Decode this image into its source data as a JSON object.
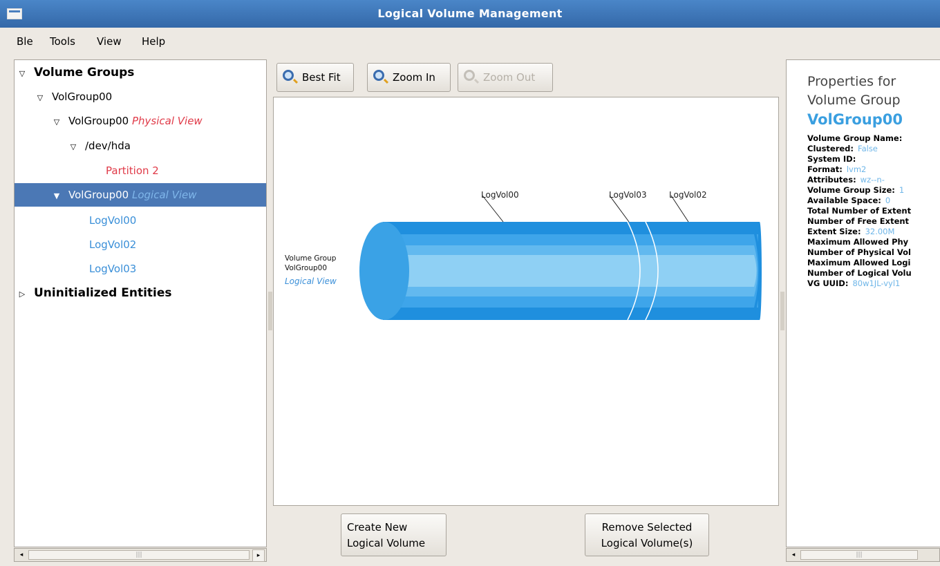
{
  "window": {
    "title": "Logical Volume Management"
  },
  "menu": [
    {
      "label": "File",
      "mnemonic": "F",
      "display": "Ble"
    },
    {
      "label": "Tools",
      "mnemonic": "T",
      "display": "Tools"
    },
    {
      "label": "View",
      "mnemonic": "V",
      "display": "View"
    },
    {
      "label": "Help",
      "mnemonic": "H",
      "display": "Help"
    }
  ],
  "tree": {
    "volume_groups": "Volume Groups",
    "vg": "VolGroup00",
    "vg_physical": "VolGroup00",
    "physical_view": "Physical View",
    "device": "/dev/hda",
    "partition": "Partition 2",
    "vg_logical": "VolGroup00",
    "logical_view": "Logical View",
    "logical_volumes": [
      "LogVol00",
      "LogVol02",
      "LogVol03"
    ],
    "uninitialized": "Uninitialized Entities"
  },
  "toolbar": {
    "best_fit": "Best Fit",
    "zoom_in": "Zoom In",
    "zoom_out": "Zoom Out"
  },
  "diagram": {
    "vg_label_line1": "Volume Group",
    "vg_label_line2": "VolGroup00",
    "vg_label_line3": "Logical View",
    "lv_labels": [
      "LogVol00",
      "LogVol03",
      "LogVol02"
    ],
    "colors": {
      "outer": "#1f8fde",
      "mid": "#57b0ea",
      "inner": "#8fd0f4",
      "cap": "#3aa2e6"
    }
  },
  "actions": {
    "create_line1": "Create New",
    "create_line2": "Logical Volume",
    "remove_line1": "Remove Selected",
    "remove_line2": "Logical Volume(s)"
  },
  "properties": {
    "heading_line1": "Properties for",
    "heading_line2": "Volume Group",
    "name": "VolGroup00",
    "fields": [
      {
        "label": "Volume Group Name:",
        "value": ""
      },
      {
        "label": "Clustered:",
        "value": "False"
      },
      {
        "label": "System ID:",
        "value": ""
      },
      {
        "label": "Format:",
        "value": "lvm2"
      },
      {
        "label": "Attributes:",
        "value": "wz--n-"
      },
      {
        "label": "Volume Group Size:",
        "value": "1"
      },
      {
        "label": "Available Space:",
        "value": "0"
      },
      {
        "label": "Total Number of Extent",
        "value": ""
      },
      {
        "label": "Number of Free Extent",
        "value": ""
      },
      {
        "label": "Extent Size:",
        "value": "32.00M"
      },
      {
        "label": "Maximum Allowed Phy",
        "value": ""
      },
      {
        "label": "Number of Physical Vol",
        "value": ""
      },
      {
        "label": "Maximum Allowed Logi",
        "value": ""
      },
      {
        "label": "Number of Logical Volu",
        "value": ""
      },
      {
        "label": "VG UUID:",
        "value": "80w1JL-vyl1"
      }
    ]
  }
}
